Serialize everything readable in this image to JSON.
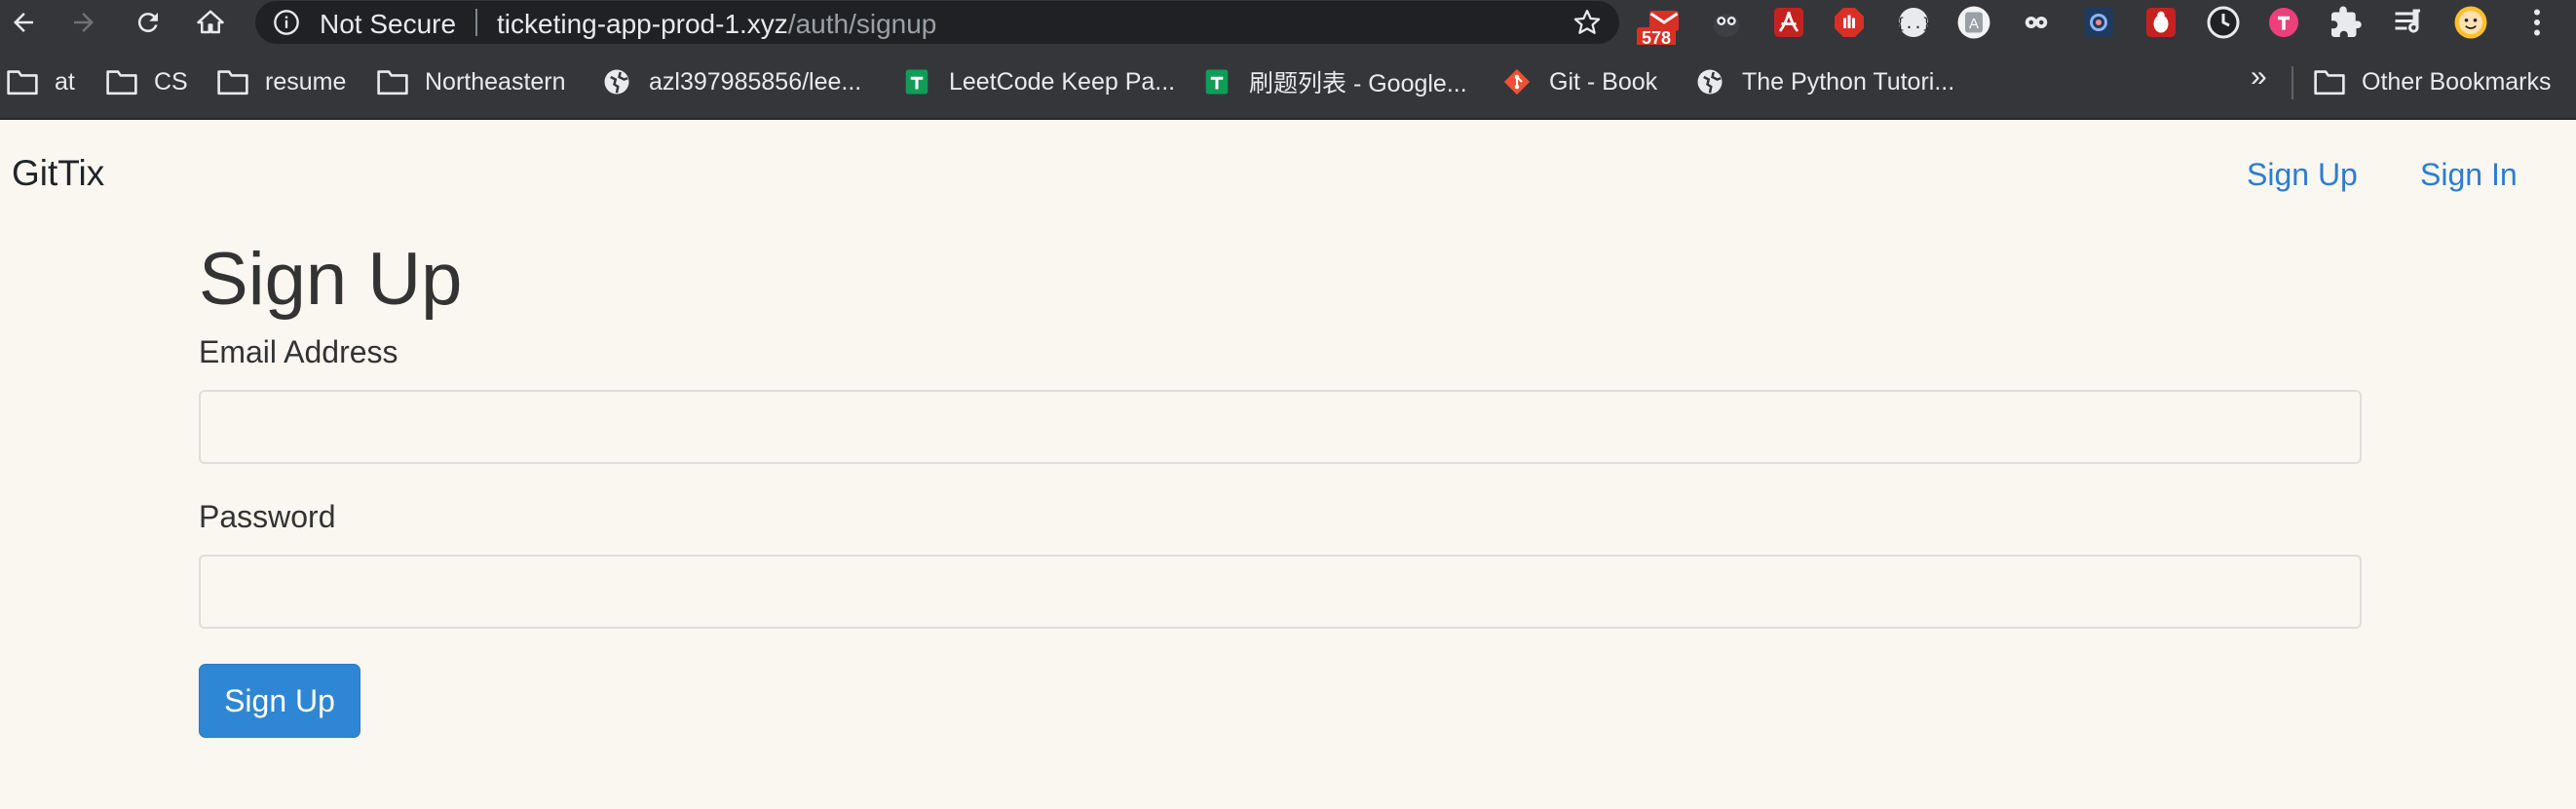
{
  "browser": {
    "security_label": "Not Secure",
    "url_host": "ticketing-app-prod-1.xyz",
    "url_path": "/auth/signup",
    "extensions": [
      {
        "name": "gmail-extension-icon",
        "badge": "578"
      },
      {
        "name": "owl-extension-icon"
      },
      {
        "name": "acrobat-extension-icon"
      },
      {
        "name": "adblock-extension-icon"
      },
      {
        "name": "json-extension-icon"
      },
      {
        "name": "translate-extension-icon"
      },
      {
        "name": "dots-extension-icon"
      },
      {
        "name": "galaxy-extension-icon"
      },
      {
        "name": "bug-extension-icon"
      },
      {
        "name": "timer-extension-icon"
      },
      {
        "name": "pink-extension-icon"
      },
      {
        "name": "puzzle-icon"
      },
      {
        "name": "playlist-icon"
      },
      {
        "name": "profile-avatar"
      },
      {
        "name": "menu-icon"
      }
    ],
    "bookmarks": [
      {
        "label": "at",
        "icon": "folder-icon"
      },
      {
        "label": "CS",
        "icon": "folder-icon"
      },
      {
        "label": "resume",
        "icon": "folder-icon"
      },
      {
        "label": "Northeastern",
        "icon": "folder-icon"
      },
      {
        "label": "azl397985856/lee...",
        "icon": "globe-icon"
      },
      {
        "label": "LeetCode Keep Pa...",
        "icon": "sheets-icon"
      },
      {
        "label": "刷题列表 - Google...",
        "icon": "sheets-icon"
      },
      {
        "label": "Git - Book",
        "icon": "git-icon"
      },
      {
        "label": "The Python Tutori...",
        "icon": "globe-icon"
      }
    ],
    "bookmarks_overflow": "»",
    "other_bookmarks": "Other Bookmarks"
  },
  "app": {
    "brand": "GitTix",
    "nav": {
      "sign_up": "Sign Up",
      "sign_in": "Sign In"
    },
    "form": {
      "title": "Sign Up",
      "email_label": "Email Address",
      "email_value": "",
      "password_label": "Password",
      "password_value": "",
      "submit_label": "Sign Up"
    }
  },
  "colors": {
    "page_background": "#faf7f0",
    "link": "#2c7cd1",
    "primary_button": "#2f86d4",
    "toolbar": "#35363a"
  }
}
